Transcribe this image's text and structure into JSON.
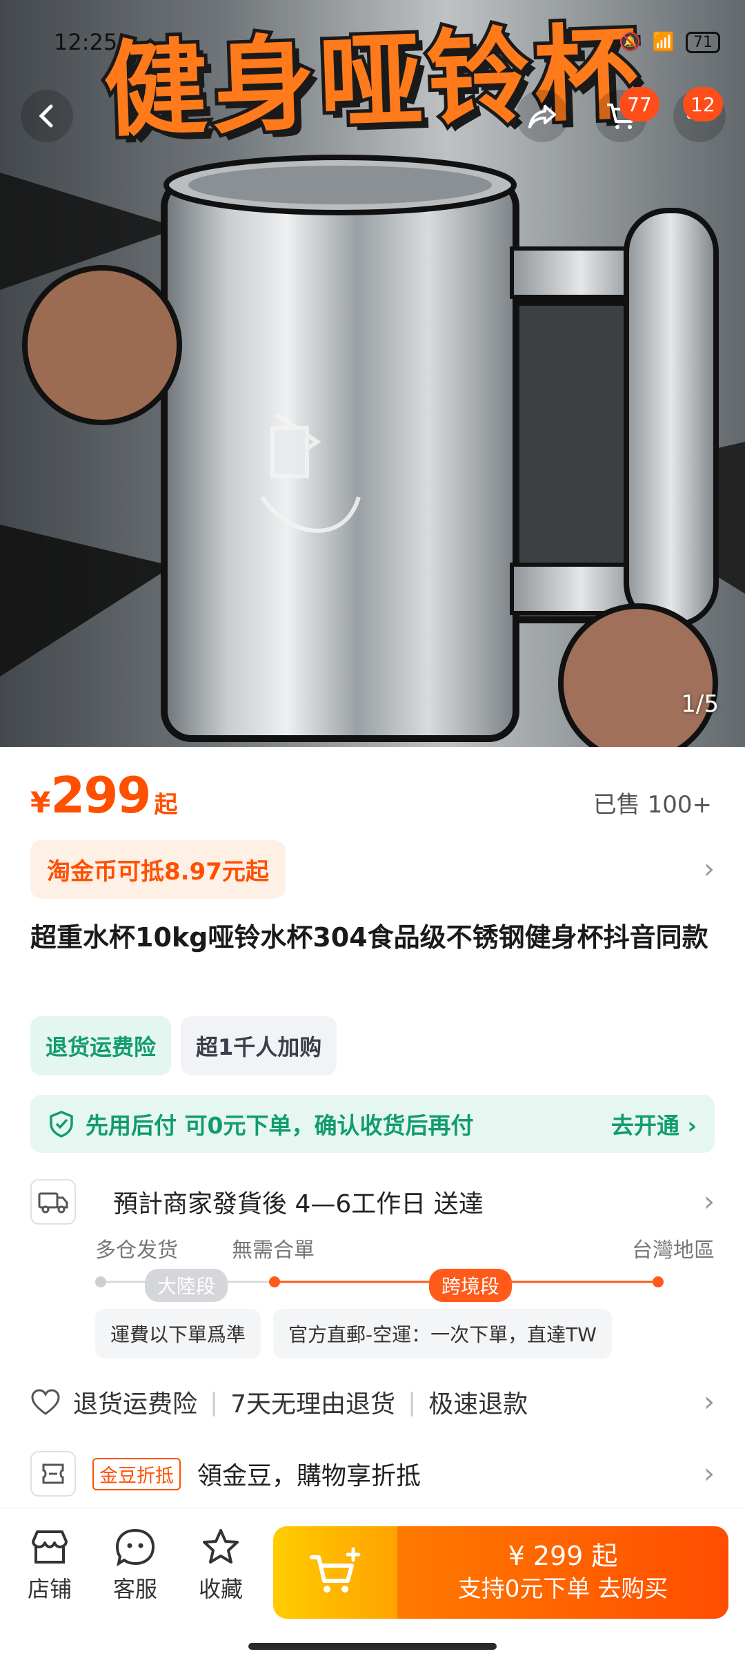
{
  "status_bar": {
    "time": "12:25",
    "battery": "71"
  },
  "hero": {
    "banner_text": "健身哑铃杯",
    "slide_indicator": "1/5",
    "cart_badge": "77",
    "more_badge": "12"
  },
  "price": {
    "currency": "¥",
    "amount": "299",
    "suffix": "起",
    "sold": "已售 100+"
  },
  "coin": {
    "label": "淘金币可抵8.97元起"
  },
  "product": {
    "title": "超重水杯10kg哑铃水杯304食品级不锈钢健身杯抖音同款"
  },
  "tags": [
    {
      "label": "退货运费险"
    },
    {
      "label": "超1千人加购"
    }
  ],
  "pay_later": {
    "label": "先用后付 可0元下单，确认收货后再付",
    "action": "去开通 ›"
  },
  "shipping": {
    "estimate": "預計商家發貨後 4—6工作日 送達",
    "origin": "多仓发货",
    "merge": "無需合單",
    "destination": "台灣地區",
    "segment_mainland": "大陸段",
    "segment_cross": "跨境段",
    "note_fee": "運費以下單爲準",
    "note_method": "官方直郵-空運：一次下單，直達TW"
  },
  "services": {
    "items": [
      "退货运费险",
      "7天无理由退货",
      "极速退款"
    ]
  },
  "beans": {
    "tag": "金豆折抵",
    "label": "領金豆，購物享折抵"
  },
  "bottom_bar": {
    "shop": "店铺",
    "service": "客服",
    "favorite": "收藏",
    "buy_price": "¥ 299 起",
    "buy_label": "支持0元下单 去购买"
  },
  "colors": {
    "accent": "#ff5000",
    "green": "#129c6b",
    "badge": "#ff4d1a"
  }
}
